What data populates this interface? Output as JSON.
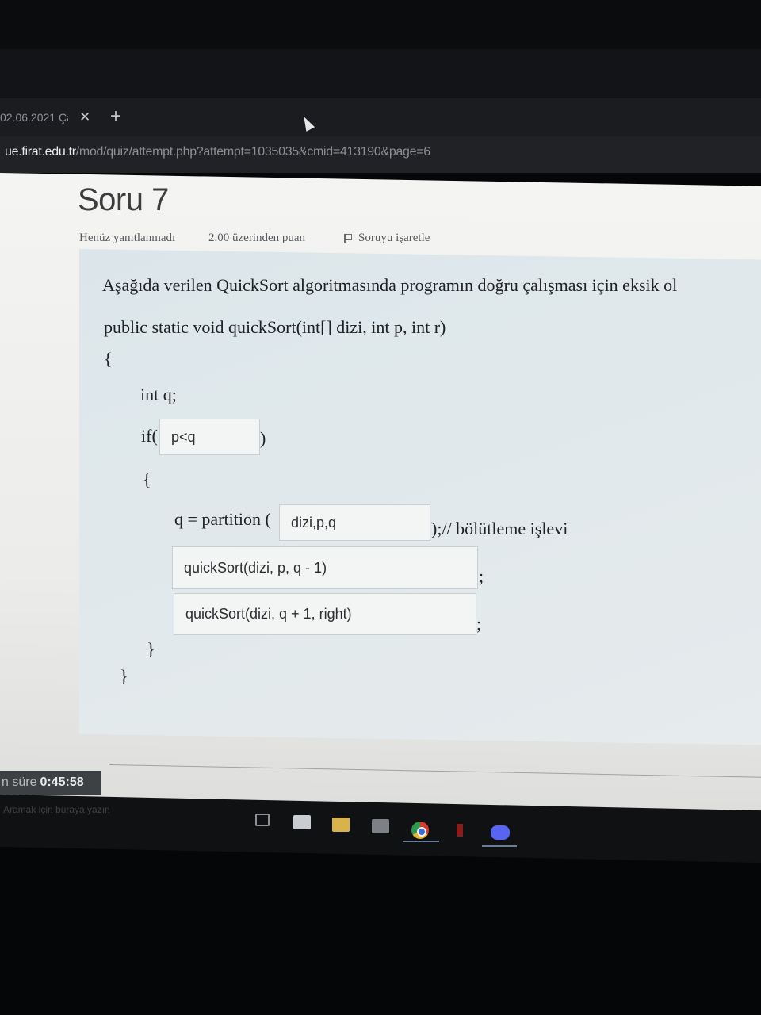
{
  "browser": {
    "tab_title": "02.06.2021 Çar",
    "tab_close": "✕",
    "new_tab": "+",
    "url_host": "ue.firat.edu.tr",
    "url_path": "/mod/quiz/attempt.php?attempt=1035035&cmid=413190&page=6"
  },
  "question": {
    "title": "Soru 7",
    "status": "Henüz yanıtlanmadı",
    "grade": "2.00 üzerinden puan",
    "flag_label": "Soruyu işaretle",
    "prompt": "Aşağıda verilen QuickSort algoritmasında programın doğru çalışması için eksik ol"
  },
  "code": {
    "signature": "public static void quickSort(int[] dizi, int p, int r)",
    "open_brace": "{",
    "decl": "int q;",
    "if_prefix": "if(",
    "if_suffix": ")",
    "inner_open": "{",
    "assign_prefix": "q = partition (",
    "assign_suffix": ");// bölütleme işlevi",
    "semicolon_1": ";",
    "semicolon_2": ";",
    "inner_close": "}",
    "close_brace": "}"
  },
  "answers": {
    "condition": "p<q",
    "partition_args": "dizi,p,q",
    "left_call": "quickSort(dizi, p, q - 1)",
    "right_call": "quickSort(dizi, q + 1, right)"
  },
  "timer": {
    "label": "n süre",
    "value": "0:45:58"
  },
  "taskbar": {
    "search_placeholder": "Aramak için buraya yazın"
  }
}
